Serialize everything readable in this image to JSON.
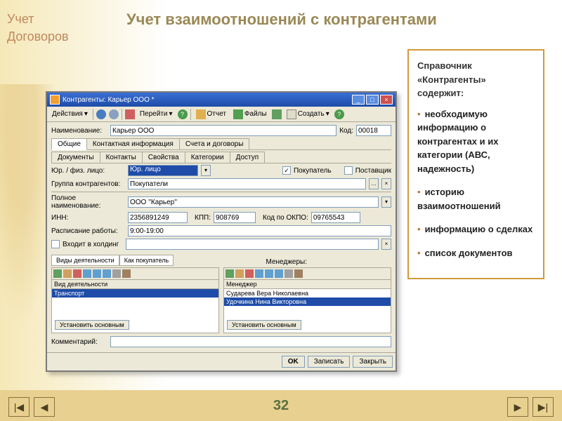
{
  "slide": {
    "side_title_l1": "Учет",
    "side_title_l2": "Договоров",
    "title": "Учет взаимоотношений с контрагентами",
    "page": "32"
  },
  "rightbox": {
    "header": "Справочник «Контрагенты» содержит:",
    "items": [
      "необходимую информацию о контрагентах и их категории (АВС, надежность)",
      "историю взаимоотношений",
      "информацию о сделках",
      "список документов"
    ]
  },
  "win": {
    "title": "Контрагенты: Карьер ООО *",
    "toolbar": {
      "actions": "Действия",
      "go": "Перейти",
      "help": "?",
      "report": "Отчет",
      "files": "Файлы",
      "create": "Создать"
    },
    "fields": {
      "name_label": "Наименование:",
      "name_value": "Карьер ООО",
      "code_label": "Код:",
      "code_value": "00018",
      "entity_label": "Юр. / физ. лицо:",
      "entity_value": "Юр. лицо",
      "buyer_label": "Покупатель",
      "supplier_label": "Поставщик",
      "group_label": "Группа контрагентов:",
      "group_value": "Покупатели",
      "fullname_label": "Полное наименование:",
      "fullname_value": "ООО ''Карьер''",
      "inn_label": "ИНН:",
      "inn_value": "2356891249",
      "kpp_label": "КПП:",
      "kpp_value": "908769",
      "okpo_label": "Код по ОКПО:",
      "okpo_value": "09765543",
      "schedule_label": "Расписание работы:",
      "schedule_value": "9:00-19:00",
      "holding_label": "Входит в холдинг",
      "comment_label": "Комментарий:"
    },
    "tabs1": {
      "t1": "Общие",
      "t2": "Контактная информация",
      "t3": "Счета и договоры"
    },
    "tabs2": {
      "t1": "Документы",
      "t2": "Контакты",
      "t3": "Свойства",
      "t4": "Категории",
      "t5": "Доступ"
    },
    "subtabs": {
      "s1": "Виды деятельности",
      "s2": "Как покупатель"
    },
    "panels": {
      "managers_label": "Менеджеры:",
      "left_head": "Вид деятельности",
      "left_item": "Транспорт",
      "right_head": "Менеджер",
      "right_r1": "Сударева Вера Николаевна",
      "right_r2": "Удочкина Нина Викторовна",
      "set_main": "Установить основным"
    },
    "buttons": {
      "ok": "OK",
      "save": "Записать",
      "close": "Закрыть"
    }
  }
}
